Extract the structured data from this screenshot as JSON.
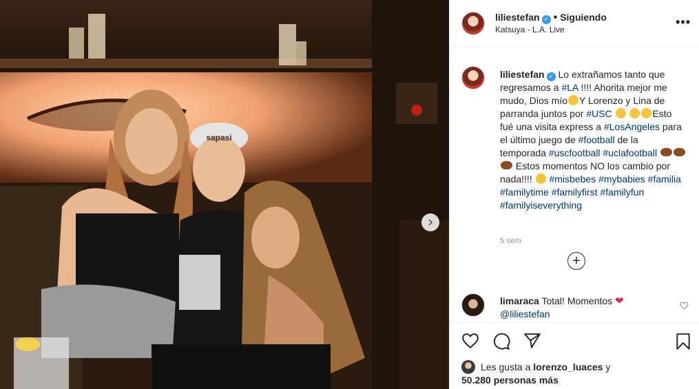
{
  "post": {
    "username": "liliestefan",
    "separator": "•",
    "follow_status": "Siguiendo",
    "location": "Katsuya - L.A. Live"
  },
  "caption": {
    "username": "liliestefan",
    "t1": "Lo extrañamos tanto que regresamos a",
    "h_la": "#LA",
    "t2": "!!!! Ahorita mejor me mudo, Dios mío",
    "t3": "Y Lorenzo y Lina de parranda juntos por",
    "h_usc": "#USC",
    "t4": "Esto fué una visita express a",
    "h_losangeles": "#LosAngeles",
    "t5": "para el último juego de",
    "h_football": "#football",
    "t6": "de la temporada",
    "h_uscfootball": "#uscfootball",
    "h_uclafootball": "#uclafootball",
    "t7": "Estos momentos NO los cambio por nada!!!!",
    "h_misbebes": "#misbebes",
    "h_mybabies": "#mybabies",
    "h_familia": "#familia",
    "h_familytime": "#familytime",
    "h_familyfirst": "#familyfirst",
    "h_familyfun": "#familyfun",
    "h_familyiseverything": "#familyiseverything"
  },
  "time_ago": "5 sem",
  "comment": {
    "username": "limaraca",
    "text": "Total! Momentos",
    "mention": "@liliestefan"
  },
  "likes": {
    "prefix": "Les gusta a",
    "user": "lorenzo_luaces",
    "conj": "y",
    "count": "50.280 personas más"
  },
  "photo": {
    "cap_text": "sapasi"
  },
  "icons": {
    "verified": "verified-badge-icon",
    "more": "more-options-icon",
    "next": "chevron-right-icon",
    "load_more": "plus-circle-icon",
    "like": "heart-icon",
    "comment": "comment-icon",
    "share": "paper-plane-icon",
    "save": "bookmark-icon"
  },
  "colors": {
    "link": "#00376b",
    "verified": "#3897f0",
    "muted": "#8e8e8e",
    "text": "#262626"
  }
}
